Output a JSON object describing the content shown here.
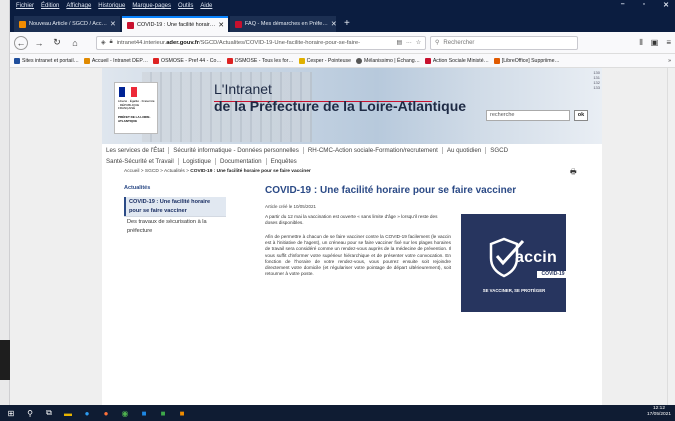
{
  "browser": {
    "menu": [
      "Fichier",
      "Édition",
      "Affichage",
      "Historique",
      "Marque-pages",
      "Outils",
      "Aide"
    ],
    "tabs": [
      {
        "label": "Nouveau Article / SGCD / Acc…",
        "color": "#f28c00",
        "active": false
      },
      {
        "label": "COVID-19 : Une facilité horair…",
        "color": "#c8102e",
        "active": true
      },
      {
        "label": "FAQ - Mes démarches en Préfe…",
        "color": "#c8102e",
        "active": false
      }
    ],
    "url_prefix": "intranet44.interieur.",
    "url_domain": "ader.gouv.fr",
    "url_path": "/SGCD/Actualites/COVID-19-Une-facilite-horaire-pour-se-faire-",
    "search_placeholder": "Rechercher",
    "bookmarks": [
      {
        "label": "Sites intranet et portail…",
        "color": "#1f4e9c"
      },
      {
        "label": "Accueil - Intranet DEP…",
        "color": "#e08a00"
      },
      {
        "label": "OSMOSE - Pref 44 - Co…",
        "color": "#d22"
      },
      {
        "label": "OSMOSE - Tous les for…",
        "color": "#d22"
      },
      {
        "label": "Cesper - Pointeuse",
        "color": "#e0b000"
      },
      {
        "label": "Mélanissimo | Échang…",
        "color": "#555"
      },
      {
        "label": "Action Sociale Ministé…",
        "color": "#c8102e"
      },
      {
        "label": "[LibreOffice] Suppriime…",
        "color": "#e05a00"
      }
    ]
  },
  "page": {
    "marianne_line1": "Liberté · Égalité · Fraternité · RÉPUBLIQUE FRANÇAISE",
    "marianne_line2": "PRÉFET DE LA LOIRE-ATLANTIQUE",
    "title1": "L'Intranet",
    "title2": "de la Préfecture de la Loire-Atlantique",
    "search_value": "recherche",
    "search_btn": "ok",
    "nav1": [
      "Les services de l'État",
      "Sécurité informatique - Données personnelles",
      "RH-CMC-Action sociale-Formation/recrutement",
      "Au quotidien",
      "SGCD"
    ],
    "nav2": [
      "Santé-Sécurité et Travail",
      "Logistique",
      "Documentation",
      "Enquêtes"
    ],
    "breadcrumb": "Accueil > SGCD > Actualités > ",
    "breadcrumb_current": "COVID-19 : Une facilité horaire pour se faire vacciner",
    "side_heading": "Actualités",
    "side_active": "COVID-19 : Une facilité horaire pour se faire vacciner",
    "side_other": "Des travaux de sécurisation à la préfecture",
    "article_title": "COVID-19 : Une facilité horaire pour se faire vacciner",
    "article_date": "Article créé le 10/05/2021",
    "article_p1": "A partir du 12 mai la vaccination est ouverte « sans limite d'âge » lorsqu'il reste des doses disponibles.",
    "article_p2": "Afin de permettre à chacun de se faire vacciner contre la COVID-19 facilement (le vaccin est à l'initiative de l'agent), un créneau pour se faire vacciner fixé sur les plages horaires de travail sera considéré comme un rendez-vous auprès de la médecine de prévention. Il vous suffit d'informer votre supérieur hiérarchique et de présenter votre convocation. En fonction de l'horaire de votre rendez-vous, vous pourrez ensuite soit rejoindre directement votre domicile (et régulariser votre pointage de départ ultérieurement), soit retourner à votre poste.",
    "vaccin_word": "accin",
    "vaccin_badge": "COVID-19",
    "vaccin_sub": "SE VACCINER, SE PROTÉGER"
  },
  "taskbar": {
    "time": "12:12",
    "date": "17/05/2021"
  }
}
